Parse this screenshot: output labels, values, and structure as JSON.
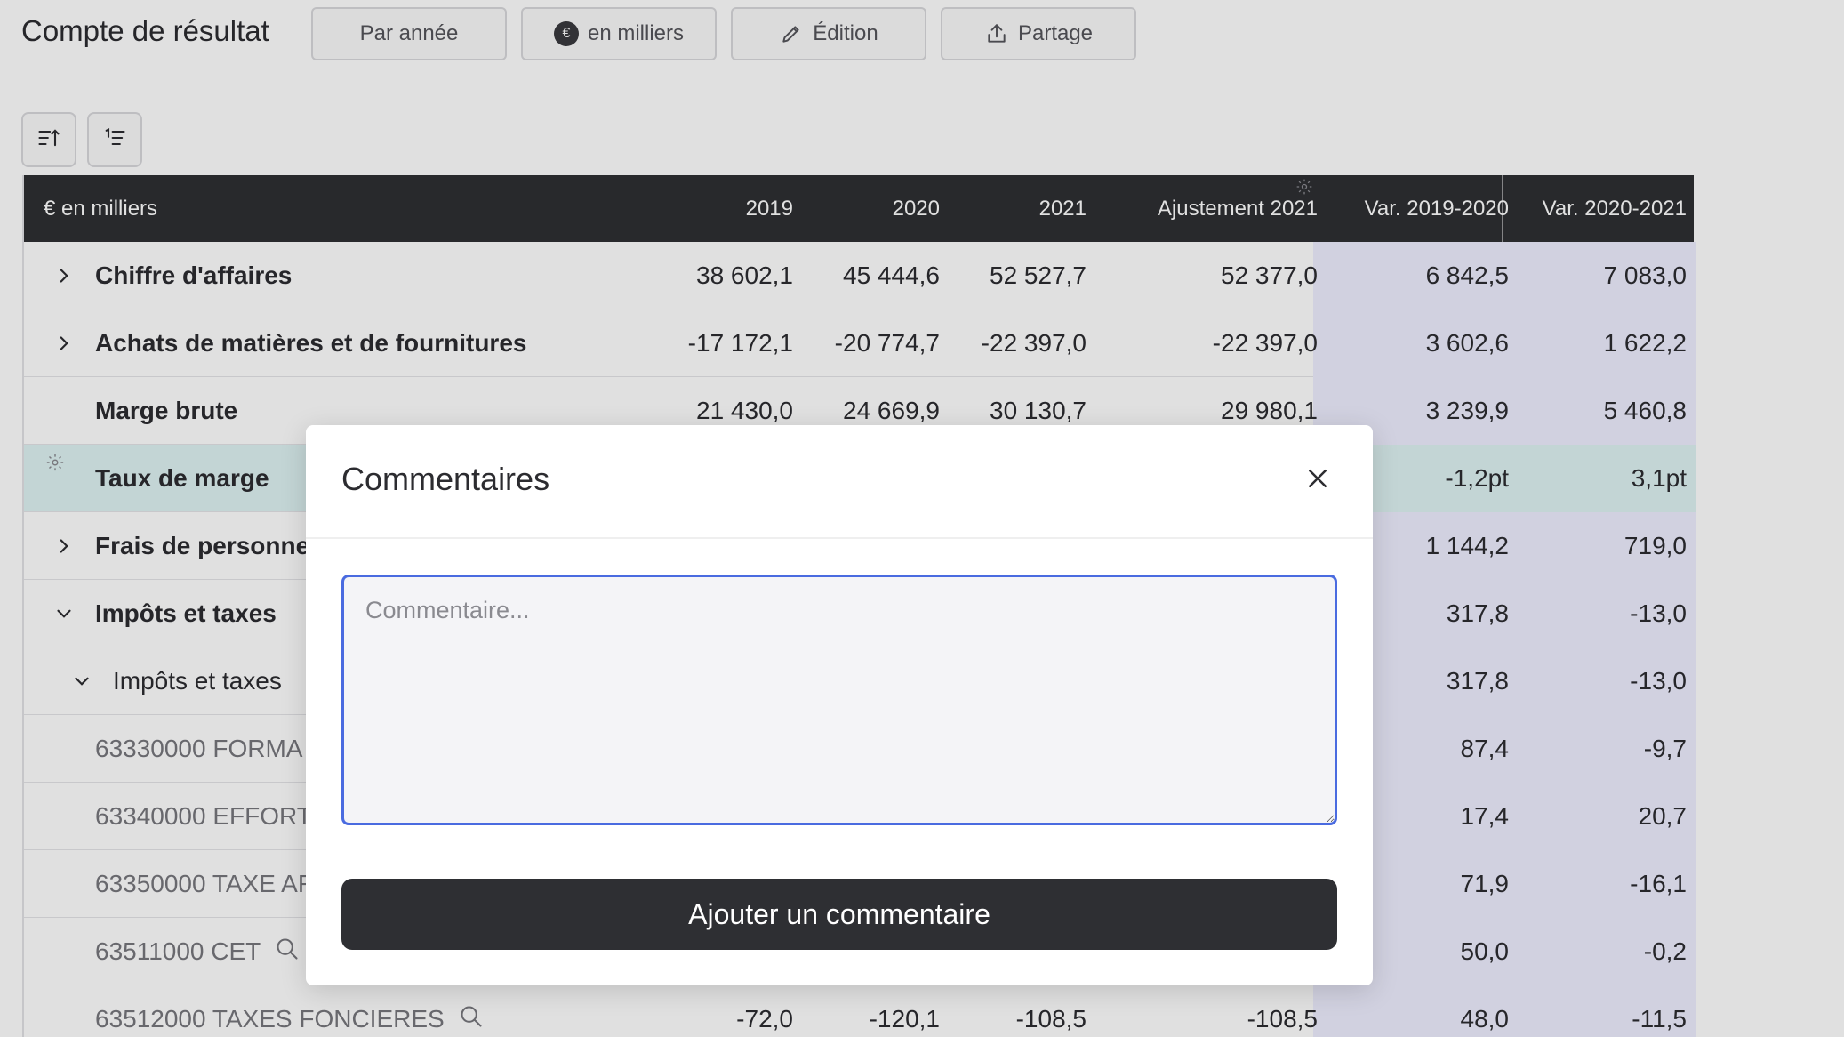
{
  "header": {
    "title": "Compte de résultat",
    "buttons": {
      "period": "Par année",
      "units": "en milliers",
      "edit": "Édition",
      "share": "Partage"
    }
  },
  "table": {
    "columns": {
      "label": "€ en milliers",
      "y2019": "2019",
      "y2020": "2020",
      "y2021": "2021",
      "adj2021": "Ajustement 2021",
      "var1920": "Var. 2019-2020",
      "var2021": "Var. 2020-2021"
    },
    "rows": [
      {
        "label": "Chiffre d'affaires",
        "v2019": "38 602,1",
        "v2020": "45 444,6",
        "v2021": "52 527,7",
        "adj": "52 377,0",
        "var1": "6 842,5",
        "var2": "7 083,0"
      },
      {
        "label": "Achats de matières et de fournitures",
        "v2019": "-17 172,1",
        "v2020": "-20 774,7",
        "v2021": "-22 397,0",
        "adj": "-22 397,0",
        "var1": "3 602,6",
        "var2": "1 622,2"
      },
      {
        "label": "Marge brute",
        "v2019": "21 430,0",
        "v2020": "24 669,9",
        "v2021": "30 130,7",
        "adj": "29 980,1",
        "var1": "3 239,9",
        "var2": "5 460,8"
      },
      {
        "label": "Taux de marge",
        "var1": "-1,2pt",
        "var2": "3,1pt"
      },
      {
        "label": "Frais de personnel",
        "var1": "1 144,2",
        "var2": "719,0"
      },
      {
        "label": "Impôts et taxes",
        "var1": "317,8",
        "var2": "-13,0"
      },
      {
        "label": "Impôts et taxes",
        "var1": "317,8",
        "var2": "-13,0"
      },
      {
        "label": "63330000 FORMA",
        "var1": "87,4",
        "var2": "-9,7"
      },
      {
        "label": "63340000 EFFORT",
        "var1": "17,4",
        "var2": "20,7"
      },
      {
        "label": "63350000 TAXE AF",
        "var1": "71,9",
        "var2": "-16,1"
      },
      {
        "label": "63511000 CET",
        "var1": "50,0",
        "var2": "-0,2"
      },
      {
        "label": "63512000 TAXES FONCIERES",
        "v2019": "-72,0",
        "v2020": "-120,1",
        "v2021": "-108,5",
        "adj": "-108,5",
        "var1": "48,0",
        "var2": "-11,5"
      }
    ]
  },
  "modal": {
    "title": "Commentaires",
    "placeholder": "Commentaire...",
    "submit_label": "Ajouter un commentaire"
  }
}
